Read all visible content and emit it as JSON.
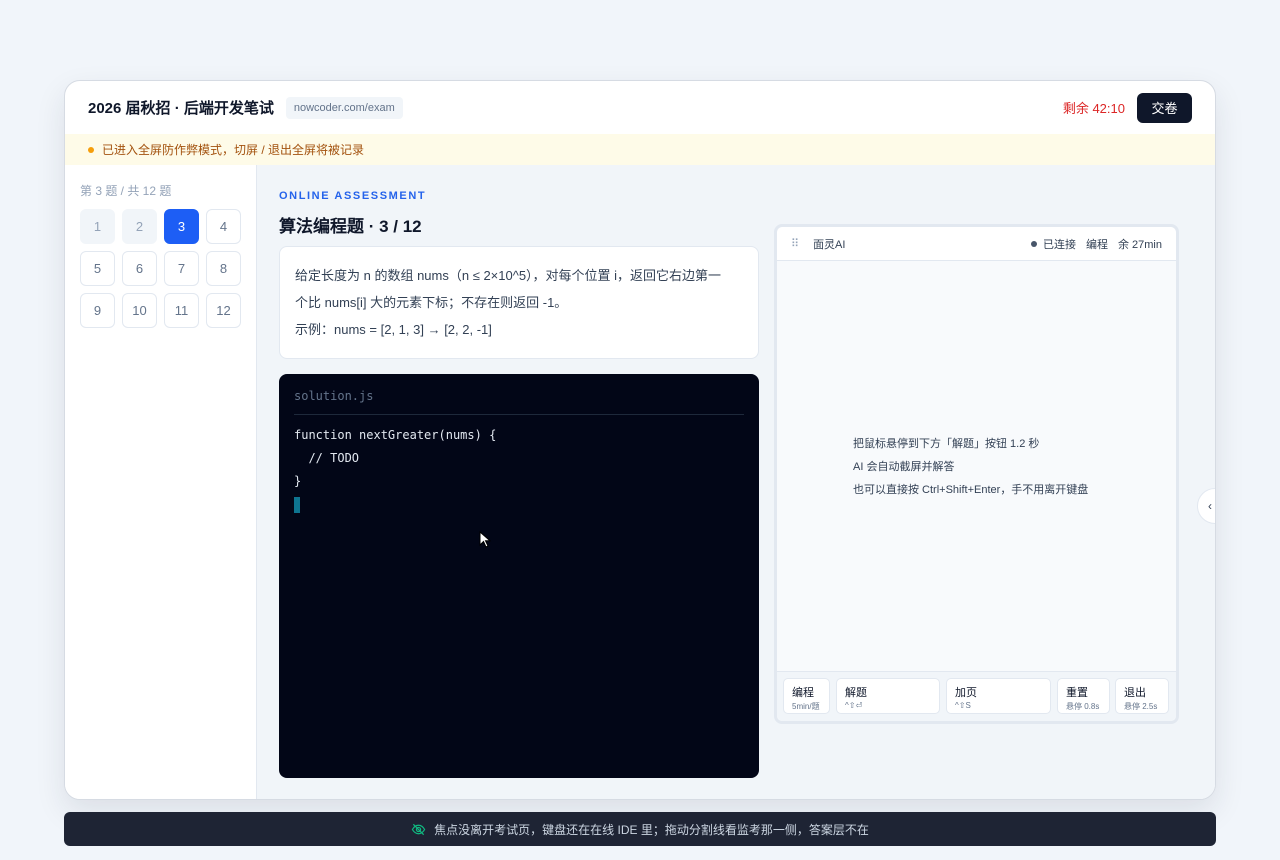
{
  "header": {
    "title": "2026 届秋招 · 后端开发笔试",
    "url": "nowcoder.com/exam",
    "timer": "剩余 42:10",
    "submit_label": "交卷"
  },
  "warning": "已进入全屏防作弊模式，切屏 / 退出全屏将被记录",
  "sidebar": {
    "count_label": "第 3 题 / 共 12 题",
    "questions": [
      {
        "num": "1",
        "state": "done"
      },
      {
        "num": "2",
        "state": "done"
      },
      {
        "num": "3",
        "state": "active"
      },
      {
        "num": "4",
        "state": "todo"
      },
      {
        "num": "5",
        "state": "todo"
      },
      {
        "num": "6",
        "state": "todo"
      },
      {
        "num": "7",
        "state": "todo"
      },
      {
        "num": "8",
        "state": "todo"
      },
      {
        "num": "9",
        "state": "todo"
      },
      {
        "num": "10",
        "state": "todo"
      },
      {
        "num": "11",
        "state": "todo"
      },
      {
        "num": "12",
        "state": "todo"
      }
    ]
  },
  "main": {
    "eyebrow": "ONLINE ASSESSMENT",
    "title": "算法编程题 · 3 / 12",
    "question_lines": [
      "给定长度为 n 的数组 nums（n ≤ 2×10^5），对每个位置 i，返回它右边第一",
      "个比 nums[i] 大的元素下标；不存在则返回 -1。",
      "示例：nums = [2, 1, 3] → [2, 2, -1]"
    ],
    "editor": {
      "file_name": "solution.js",
      "code_lines": [
        "function nextGreater(nums) {",
        "  // TODO",
        "}"
      ]
    }
  },
  "ai_panel": {
    "drag_icon": "⠿",
    "name": "面灵AI",
    "status": "已连接",
    "mode": "编程",
    "remaining": "余 27min",
    "hints": [
      "把鼠标悬停到下方「解题」按钮 1.2 秒",
      "AI 会自动截屏并解答",
      "也可以直接按 Ctrl+Shift+Enter，手不用离开键盘"
    ],
    "buttons": [
      {
        "label": "编程",
        "sub": "5min/题"
      },
      {
        "label": "解题",
        "sub": "^⇧⏎"
      },
      {
        "label": "加页",
        "sub": "^⇧S"
      },
      {
        "label": "重置",
        "sub": "悬停 0.8s"
      },
      {
        "label": "退出",
        "sub": "悬停 2.5s"
      }
    ]
  },
  "collapse_icon": "‹",
  "toast": "焦点没离开考试页，键盘还在在线 IDE 里；拖动分割线看监考那一侧，答案层不在",
  "colors": {
    "accent": "#1d5ef5",
    "timer": "#dc2626",
    "warning_text": "#a3520e",
    "editor_bg": "#020617"
  }
}
